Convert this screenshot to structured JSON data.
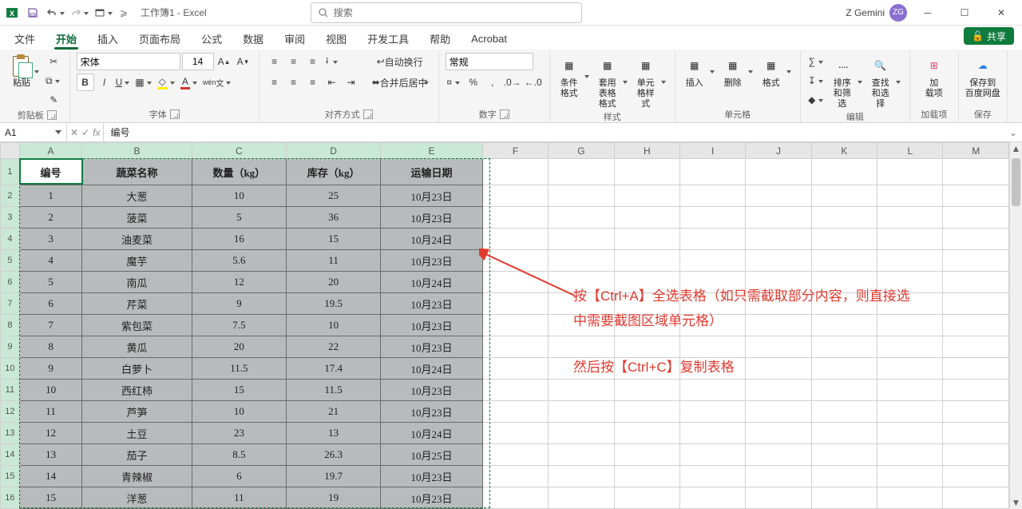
{
  "titlebar": {
    "doc_title": "工作簿1 - Excel",
    "search_placeholder": "搜索",
    "user_name": "Z Gemini",
    "user_initials": "ZG"
  },
  "tabs": {
    "file": "文件",
    "home": "开始",
    "insert": "插入",
    "page": "页面布局",
    "formula": "公式",
    "data": "数据",
    "review": "审阅",
    "view": "视图",
    "dev": "开发工具",
    "help": "帮助",
    "acrobat": "Acrobat",
    "share": "共享"
  },
  "ribbon": {
    "clipboard": {
      "paste": "粘贴",
      "label": "剪贴板"
    },
    "font": {
      "name": "宋体",
      "size": "14",
      "label": "字体"
    },
    "align": {
      "wrap": "自动换行",
      "merge": "合并后居中",
      "label": "对齐方式"
    },
    "number": {
      "format": "常规",
      "label": "数字"
    },
    "styles": {
      "cond": "条件格式",
      "table": "套用\n表格格式",
      "cell": "单元格样式",
      "label": "样式"
    },
    "cells": {
      "insert": "插入",
      "delete": "删除",
      "format": "格式",
      "label": "单元格"
    },
    "editing": {
      "sort": "排序和筛选",
      "find": "查找和选择",
      "label": "编辑"
    },
    "addins": {
      "load": "加\n载项",
      "label": "加载项"
    },
    "save": {
      "baidu": "保存到\n百度网盘",
      "label": "保存"
    }
  },
  "fx": {
    "cell": "A1",
    "value": "编号"
  },
  "columns": [
    "A",
    "B",
    "C",
    "D",
    "E",
    "F",
    "G",
    "H",
    "I",
    "J",
    "K",
    "L",
    "M"
  ],
  "sheet": {
    "headers": [
      "编号",
      "蔬菜名称",
      "数量（kg）",
      "库存（kg）",
      "运输日期"
    ],
    "rows": [
      [
        "1",
        "大葱",
        "10",
        "25",
        "10月23日"
      ],
      [
        "2",
        "菠菜",
        "5",
        "36",
        "10月23日"
      ],
      [
        "3",
        "油麦菜",
        "16",
        "15",
        "10月24日"
      ],
      [
        "4",
        "魔芋",
        "5.6",
        "11",
        "10月23日"
      ],
      [
        "5",
        "南瓜",
        "12",
        "20",
        "10月24日"
      ],
      [
        "6",
        "芹菜",
        "9",
        "19.5",
        "10月23日"
      ],
      [
        "7",
        "紫包菜",
        "7.5",
        "10",
        "10月23日"
      ],
      [
        "8",
        "黄瓜",
        "20",
        "22",
        "10月23日"
      ],
      [
        "9",
        "白萝卜",
        "11.5",
        "17.4",
        "10月24日"
      ],
      [
        "10",
        "西红柿",
        "15",
        "11.5",
        "10月23日"
      ],
      [
        "11",
        "芦笋",
        "10",
        "21",
        "10月23日"
      ],
      [
        "12",
        "土豆",
        "23",
        "13",
        "10月24日"
      ],
      [
        "13",
        "茄子",
        "8.5",
        "26.3",
        "10月25日"
      ],
      [
        "14",
        "青辣椒",
        "6",
        "19.7",
        "10月23日"
      ],
      [
        "15",
        "洋葱",
        "11",
        "19",
        "10月23日"
      ]
    ]
  },
  "annotation": {
    "line1": "按【Ctrl+A】全选表格（如只需截取部分内容，则直接选",
    "line2": "中需要截图区域单元格）",
    "line3": "然后按【Ctrl+C】复制表格"
  },
  "colors": {
    "excel_green": "#107c41",
    "sel_fill": "#b8bbbb",
    "anno_red": "#e03a2f"
  }
}
